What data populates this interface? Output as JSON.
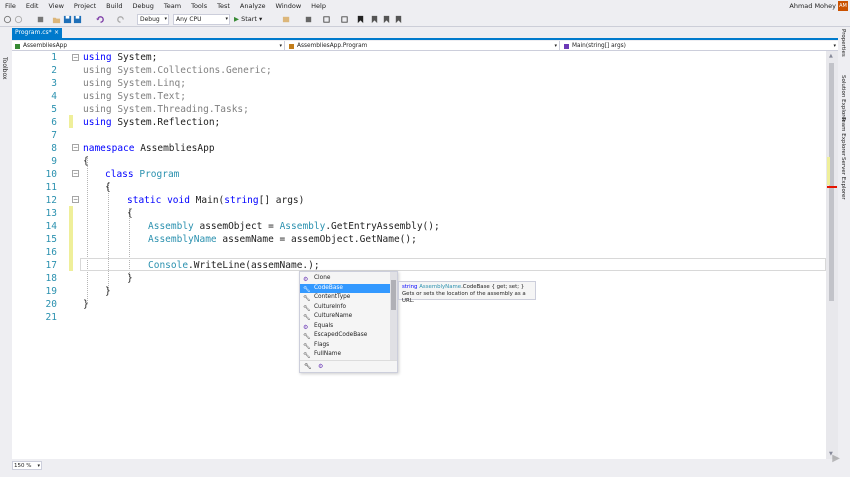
{
  "menu": [
    "File",
    "Edit",
    "View",
    "Project",
    "Build",
    "Debug",
    "Team",
    "Tools",
    "Test",
    "Analyze",
    "Window",
    "Help"
  ],
  "user": {
    "name": "Ahmad Mohey",
    "initials": "AM"
  },
  "toolbar": {
    "config": "Debug",
    "platform": "Any CPU",
    "start": "Start"
  },
  "sidebars": {
    "left": "Toolbox",
    "right": [
      "Properties",
      "Solution Explorer",
      "Team Explorer",
      "Server Explorer"
    ]
  },
  "tab": {
    "name": "Program.cs*",
    "close": "×"
  },
  "navbar": {
    "project": "AssembliesApp",
    "type": "AssembliesApp.Program",
    "member": "Main(string[] args)"
  },
  "code": {
    "line_numbers": [
      "1",
      "2",
      "3",
      "4",
      "5",
      "6",
      "7",
      "8",
      "9",
      "10",
      "11",
      "12",
      "13",
      "14",
      "15",
      "16",
      "17",
      "18",
      "19",
      "20",
      "21"
    ],
    "l1_kw": "using",
    "l1_rest": " System;",
    "l2": "using System.Collections.Generic;",
    "l3": "using System.Linq;",
    "l4": "using System.Text;",
    "l5": "using System.Threading.Tasks;",
    "l6_kw": "using",
    "l6_rest": " System.Reflection;",
    "l8_kw": "namespace",
    "l8_rest": " AssembliesApp",
    "l9": "{",
    "l10_kw": "class",
    "l10_ty": "Program",
    "l11": "{",
    "l12_kw1": "static",
    "l12_kw2": "void",
    "l12_a": " Main(",
    "l12_kw3": "string",
    "l12_b": "[] args)",
    "l13": "{",
    "l14_ty1": "Assembly",
    "l14_a": " assemObject = ",
    "l14_ty2": "Assembly",
    "l14_b": ".GetEntryAssembly();",
    "l15_ty": "AssemblyName",
    "l15_rest": " assemName = assemObject.GetName();",
    "l17_ty": "Console",
    "l17_rest": ".WriteLine(assemName.);",
    "l18": "}",
    "l19": "}",
    "l20": "}"
  },
  "completion": {
    "items": [
      {
        "label": "Clone",
        "icon": "method-icon"
      },
      {
        "label": "CodeBase",
        "icon": "wrench-icon",
        "selected": true
      },
      {
        "label": "ContentType",
        "icon": "wrench-icon"
      },
      {
        "label": "CultureInfo",
        "icon": "wrench-icon"
      },
      {
        "label": "CultureName",
        "icon": "wrench-icon"
      },
      {
        "label": "Equals",
        "icon": "method-icon"
      },
      {
        "label": "EscapedCodeBase",
        "icon": "wrench-icon"
      },
      {
        "label": "Flags",
        "icon": "wrench-icon"
      },
      {
        "label": "FullName",
        "icon": "wrench-icon"
      }
    ]
  },
  "tooltip": {
    "kw": "string",
    "type": "AssemblyName",
    "sig": ".CodeBase { get; set; }",
    "desc": "Gets or sets the location of the assembly as a URL."
  },
  "zoom": "150 %",
  "colors": {
    "accent": "#007acc",
    "keyword": "#0000ff",
    "type": "#2b91af",
    "selection": "#3399ff",
    "change_marker": "#efef9a"
  }
}
